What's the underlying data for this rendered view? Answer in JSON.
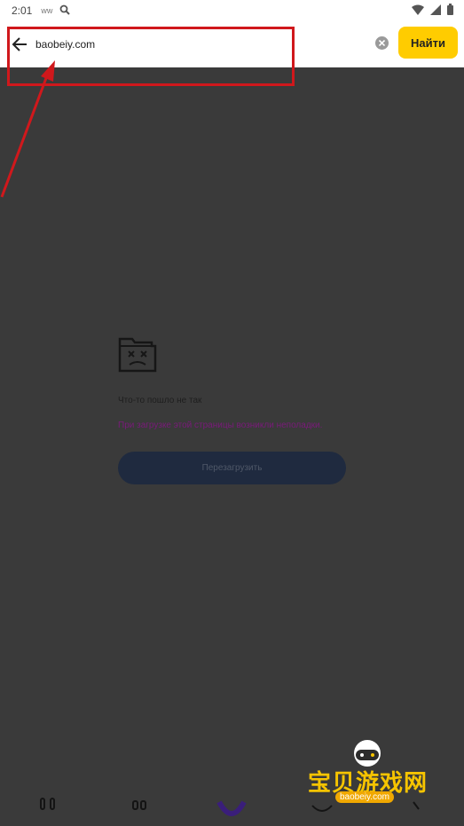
{
  "status_bar": {
    "time": "2:01",
    "notification_glyph": "ww",
    "icons": [
      "notification-icon",
      "search-icon",
      "wifi-icon",
      "signal-icon",
      "battery-icon"
    ]
  },
  "search_bar": {
    "url_value": "baobeiy.com",
    "find_label": "Найти",
    "accent_color": "#ffcc00"
  },
  "error_page": {
    "icon": "broken-folder-icon",
    "title": "Что-то пошло не так",
    "description": "При загрузке этой страницы возникли неполадки.",
    "reload_label": "Перезагрузить"
  },
  "annotation": {
    "color": "#d0181c"
  },
  "bottom_nav": {
    "items": [
      "tabs-icon",
      "grid-icon",
      "alice-icon",
      "chat-icon",
      "search-icon"
    ]
  },
  "watermark": {
    "text": "宝贝游戏网",
    "subtext": "baobeiy.com"
  }
}
